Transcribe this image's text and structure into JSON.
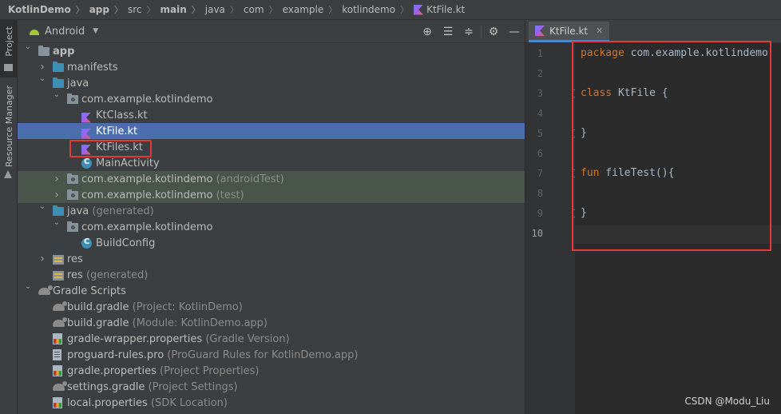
{
  "breadcrumb": [
    {
      "label": "KotlinDemo",
      "bold": true
    },
    {
      "label": "app",
      "bold": true
    },
    {
      "label": "src",
      "bold": false
    },
    {
      "label": "main",
      "bold": true
    },
    {
      "label": "java",
      "bold": false
    },
    {
      "label": "com",
      "bold": false
    },
    {
      "label": "example",
      "bold": false
    },
    {
      "label": "kotlindemo",
      "bold": false
    },
    {
      "label": "KtFile.kt",
      "bold": false,
      "icon": "kotlin-file-icon"
    }
  ],
  "tool_strip": {
    "project_label": "Project",
    "resource_manager_label": "Resource Manager"
  },
  "project_panel": {
    "view_selector": "Android",
    "header_icons": [
      "locate-icon",
      "expand-all-icon",
      "collapse-all-icon",
      "gear-icon",
      "minimize-icon"
    ],
    "tree": [
      {
        "indent": 0,
        "arrow": "down",
        "icon": "folder",
        "label": "app",
        "bold": true
      },
      {
        "indent": 1,
        "arrow": "right",
        "icon": "folder-blue",
        "label": "manifests"
      },
      {
        "indent": 1,
        "arrow": "down",
        "icon": "folder-blue",
        "label": "java"
      },
      {
        "indent": 2,
        "arrow": "down",
        "icon": "package",
        "label": "com.example.kotlindemo"
      },
      {
        "indent": 3,
        "arrow": "",
        "icon": "kotlin",
        "label": "KtClass.kt"
      },
      {
        "indent": 3,
        "arrow": "",
        "icon": "kotlin",
        "label": "KtFile.kt",
        "selected": true
      },
      {
        "indent": 3,
        "arrow": "",
        "icon": "kotlin",
        "label": "KtFiles.kt"
      },
      {
        "indent": 3,
        "arrow": "",
        "icon": "class",
        "label": "MainActivity"
      },
      {
        "indent": 2,
        "arrow": "right",
        "icon": "package",
        "label": "com.example.kotlindemo",
        "suffix": "(androidTest)",
        "test": true
      },
      {
        "indent": 2,
        "arrow": "right",
        "icon": "package",
        "label": "com.example.kotlindemo",
        "suffix": "(test)",
        "test": true
      },
      {
        "indent": 1,
        "arrow": "down",
        "icon": "folder-blue",
        "label": "java",
        "suffix": "(generated)"
      },
      {
        "indent": 2,
        "arrow": "down",
        "icon": "package",
        "label": "com.example.kotlindemo"
      },
      {
        "indent": 3,
        "arrow": "",
        "icon": "class",
        "label": "BuildConfig"
      },
      {
        "indent": 1,
        "arrow": "right",
        "icon": "res",
        "label": "res"
      },
      {
        "indent": 1,
        "arrow": "",
        "icon": "res",
        "label": "res",
        "suffix": "(generated)"
      },
      {
        "indent": 0,
        "arrow": "down",
        "icon": "gradle",
        "label": "Gradle Scripts"
      },
      {
        "indent": 1,
        "arrow": "",
        "icon": "gradle",
        "label": "build.gradle",
        "suffix": "(Project: KotlinDemo)"
      },
      {
        "indent": 1,
        "arrow": "",
        "icon": "gradle",
        "label": "build.gradle",
        "suffix": "(Module: KotlinDemo.app)"
      },
      {
        "indent": 1,
        "arrow": "",
        "icon": "properties",
        "label": "gradle-wrapper.properties",
        "suffix": "(Gradle Version)"
      },
      {
        "indent": 1,
        "arrow": "",
        "icon": "pro",
        "label": "proguard-rules.pro",
        "suffix": "(ProGuard Rules for KotlinDemo.app)"
      },
      {
        "indent": 1,
        "arrow": "",
        "icon": "properties",
        "label": "gradle.properties",
        "suffix": "(Project Properties)"
      },
      {
        "indent": 1,
        "arrow": "",
        "icon": "gradle",
        "label": "settings.gradle",
        "suffix": "(Project Settings)"
      },
      {
        "indent": 1,
        "arrow": "",
        "icon": "properties",
        "label": "local.properties",
        "suffix": "(SDK Location)"
      }
    ]
  },
  "editor": {
    "tab_label": "KtFile.kt",
    "lines": [
      {
        "num": "1",
        "code": [
          {
            "t": "package",
            "k": true
          },
          {
            "t": " com.example.kotlindemo",
            "k": false
          }
        ]
      },
      {
        "num": "2",
        "code": []
      },
      {
        "num": "3",
        "code": [
          {
            "t": "class",
            "k": true
          },
          {
            "t": " KtFile {",
            "k": false
          }
        ],
        "fold": true
      },
      {
        "num": "4",
        "code": []
      },
      {
        "num": "5",
        "code": [
          {
            "t": "}",
            "k": false
          }
        ],
        "fold": true
      },
      {
        "num": "6",
        "code": []
      },
      {
        "num": "7",
        "code": [
          {
            "t": "fun",
            "k": true
          },
          {
            "t": " fileTest(){",
            "k": false
          }
        ],
        "fold": true
      },
      {
        "num": "8",
        "code": []
      },
      {
        "num": "9",
        "code": [
          {
            "t": "}",
            "k": false
          }
        ],
        "fold": true
      },
      {
        "num": "10",
        "code": [],
        "current": true
      }
    ]
  },
  "watermark": "CSDN @Modu_Liu",
  "colors": {
    "selection": "#4b6eaf",
    "test_row": "#49544a",
    "keyword": "#cc7832",
    "annotation_box": "#e53935"
  }
}
